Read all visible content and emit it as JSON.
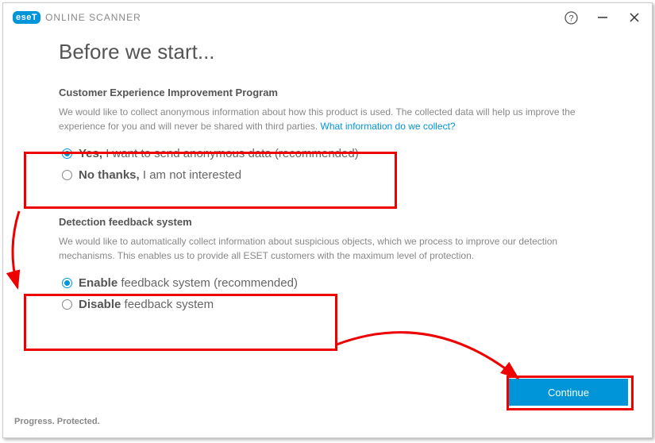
{
  "titlebar": {
    "logo_badge": "eseT",
    "logo_text": "ONLINE SCANNER"
  },
  "heading": "Before we start...",
  "section1": {
    "title": "Customer Experience Improvement Program",
    "desc": "We would like to collect anonymous information about how this product is used. The collected data will help us improve the experience for you and will never be shared with third parties. ",
    "link": "What information do we collect?",
    "opt_yes_bold": "Yes,",
    "opt_yes_rest": " I want to send anonymous data (recommended)",
    "opt_no_bold": "No thanks,",
    "opt_no_rest": " I am not interested"
  },
  "section2": {
    "title": "Detection feedback system",
    "desc": "We would like to automatically collect information about suspicious objects, which we process to improve our detection mechanisms. This enables us to provide all ESET customers with the maximum level of protection.",
    "opt_enable_bold": "Enable",
    "opt_enable_rest": " feedback system (recommended)",
    "opt_disable_bold": "Disable",
    "opt_disable_rest": " feedback system"
  },
  "continue_label": "Continue",
  "tagline": "Progress. Protected."
}
